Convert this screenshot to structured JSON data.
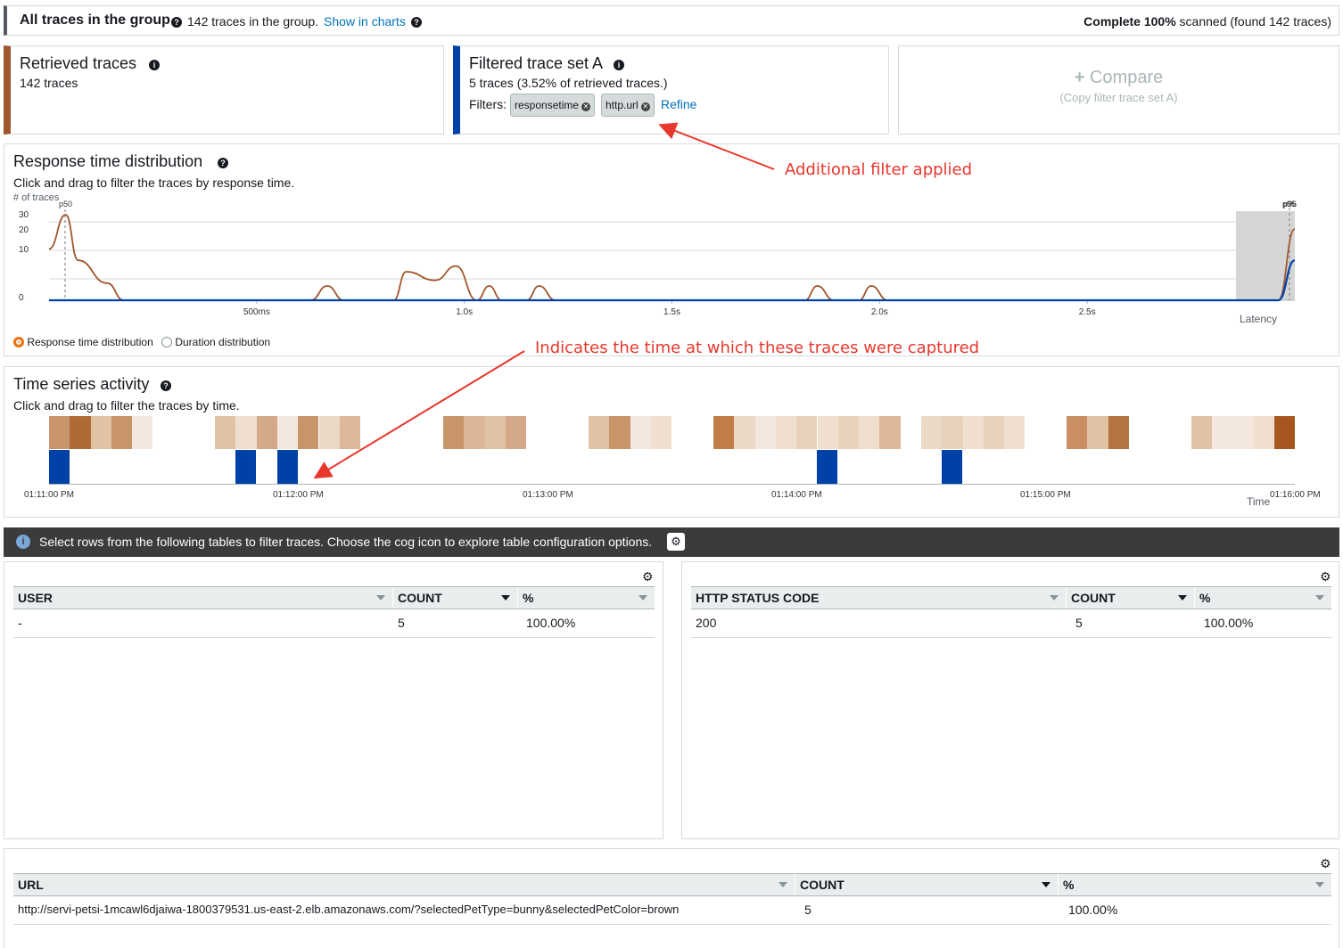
{
  "header": {
    "title": "All traces in the group",
    "count_text": "142 traces in the group.",
    "show_in_charts": "Show in charts",
    "status_bold": "Complete 100%",
    "status_rest": "scanned (found 142 traces)"
  },
  "cards": {
    "retrieved": {
      "title": "Retrieved traces",
      "subtitle": "142 traces",
      "accent": "#a0562c"
    },
    "filtered": {
      "title": "Filtered trace set A",
      "subtitle": "5 traces (3.52% of retrieved traces.)",
      "filters_label": "Filters:",
      "filters": [
        "responsetime",
        "http.url"
      ],
      "refine": "Refine",
      "accent": "#0041a8"
    },
    "compare": {
      "title": "Compare",
      "subtitle": "(Copy filter trace set A)"
    }
  },
  "annotations": {
    "filter_applied": "Additional filter applied",
    "time_captured": "Indicates the time at which these traces were captured"
  },
  "response_time": {
    "title": "Response time distribution",
    "subtitle": "Click and drag to filter the traces by response time.",
    "radio_selected": "Response time distribution",
    "radio_other": "Duration distribution"
  },
  "chart_data": {
    "type": "line",
    "ylabel": "# of traces",
    "xlabel": "Latency",
    "y_ticks": [
      "30",
      "20",
      "10",
      "0"
    ],
    "x_ticks": [
      "500ms",
      "1.0s",
      "1.5s",
      "2.0s",
      "2.5s"
    ],
    "markers": [
      "p50",
      "p95",
      "p96"
    ],
    "series": [
      {
        "color": "#a0562c",
        "points": [
          [
            0.0,
            18
          ],
          [
            0.04,
            30
          ],
          [
            0.07,
            14
          ],
          [
            0.14,
            6
          ],
          [
            0.18,
            0
          ],
          [
            0.63,
            0
          ],
          [
            0.67,
            5
          ],
          [
            0.71,
            0
          ],
          [
            0.83,
            0
          ],
          [
            0.86,
            10
          ],
          [
            0.93,
            7
          ],
          [
            0.98,
            12
          ],
          [
            1.03,
            0
          ],
          [
            1.06,
            5
          ],
          [
            1.09,
            0
          ],
          [
            1.15,
            0
          ],
          [
            1.18,
            5
          ],
          [
            1.22,
            0
          ],
          [
            1.82,
            0
          ],
          [
            1.85,
            5
          ],
          [
            1.89,
            0
          ],
          [
            1.95,
            0
          ],
          [
            1.98,
            5
          ],
          [
            2.02,
            0
          ],
          [
            2.96,
            0
          ],
          [
            3.0,
            25
          ]
        ]
      },
      {
        "color": "#0041a8",
        "points": [
          [
            0.0,
            0
          ],
          [
            2.96,
            0
          ],
          [
            3.0,
            14
          ]
        ]
      }
    ]
  },
  "time_series": {
    "title": "Time series activity",
    "subtitle": "Click and drag to filter the traces by time.",
    "x_ticks": [
      "01:11:00 PM",
      "01:12:00 PM",
      "01:13:00 PM",
      "01:14:00 PM",
      "01:15:00 PM",
      "01:16:00 PM"
    ],
    "axis_label": "Time",
    "heat_colors": [
      "#c8956a",
      "#b06a35",
      "#e2c2a4",
      "#c8956a",
      "#f4e8de",
      "#e2c2a4",
      "#f0dfcf",
      "#d3a98a",
      "#f4e8de",
      "#c8956a",
      "#ecd8c6",
      "#ddb898",
      "#c8956a",
      "#dcb797",
      "#e2c2a4",
      "#d3a98a",
      "#e2c2a4",
      "#c8956a",
      "#f4e8de",
      "#f0dfcf",
      "#c27c46",
      "#ecd8c6",
      "#f4e8de",
      "#f0dfcf",
      "#e9d2bc",
      "#f0dfcf",
      "#e9d2bc",
      "#f0dfcf",
      "#ddb898",
      "#ecd8c6",
      "#e9d2bc",
      "#f0dfcf",
      "#e9d2bc",
      "#f0dfcf",
      "#c98f62",
      "#e2c2a4",
      "#b5733f",
      "#e2c2a4",
      "#f4e8de",
      "#f4e8de",
      "#f0dfcf",
      "#a8561f",
      "#f4e8de",
      "#f0dfcf",
      "#ecd8c6",
      "#c98f62",
      "#f4e8de"
    ],
    "blue_bars": 5
  },
  "info_banner": {
    "text": "Select rows from the following tables to filter traces. Choose the cog icon to explore table configuration options."
  },
  "tables": {
    "user": {
      "headers": [
        "USER",
        "COUNT",
        "%"
      ],
      "rows": [
        [
          "-",
          "5",
          "100.00%"
        ]
      ]
    },
    "status": {
      "headers": [
        "HTTP STATUS CODE",
        "COUNT",
        "%"
      ],
      "rows": [
        [
          "200",
          "5",
          "100.00%"
        ]
      ]
    },
    "url": {
      "headers": [
        "URL",
        "COUNT",
        "%"
      ],
      "rows": [
        [
          "http://servi-petsi-1mcawl6djaiwa-1800379531.us-east-2.elb.amazonaws.com/?selectedPetType=bunny&selectedPetColor=brown",
          "5",
          "100.00%"
        ]
      ]
    }
  }
}
